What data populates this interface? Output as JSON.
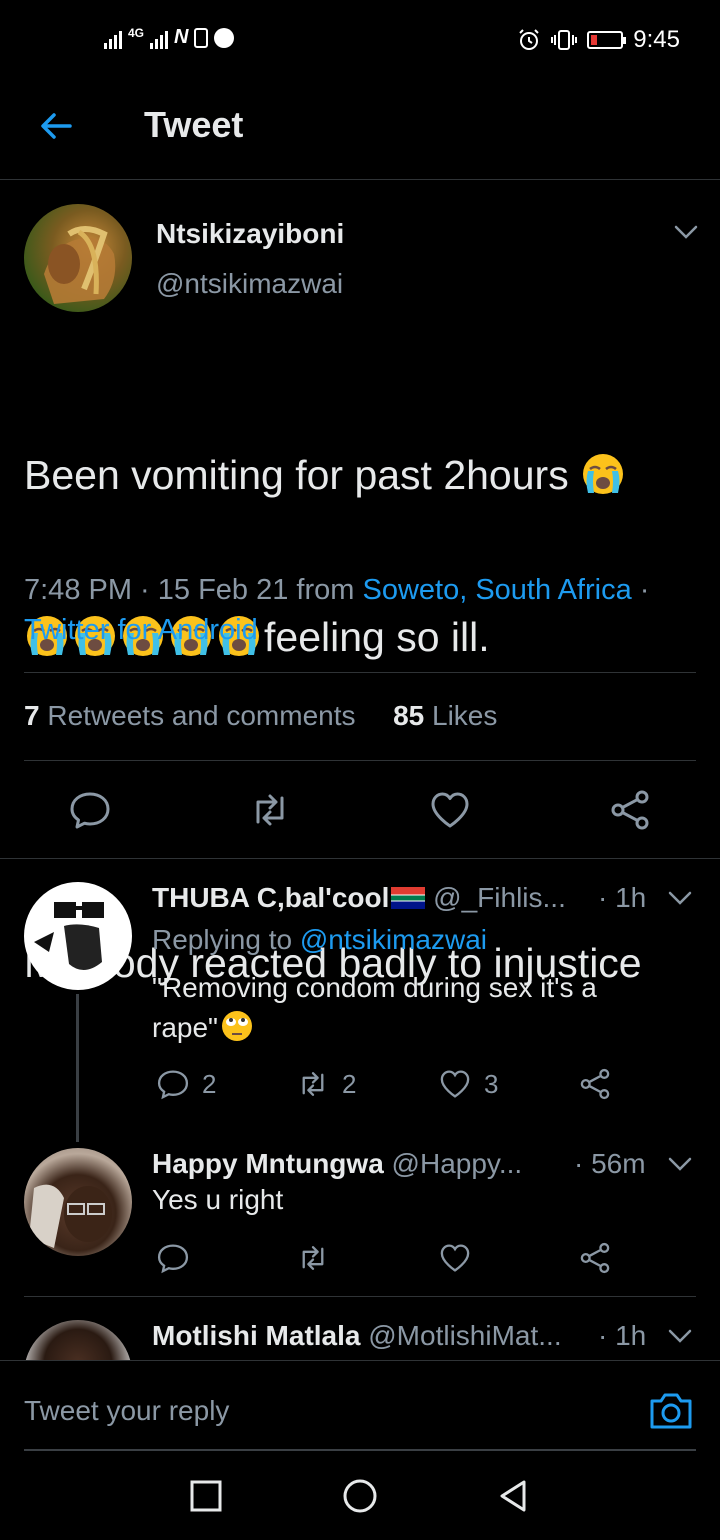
{
  "status_bar": {
    "network": "4G",
    "carrier_badge": "N",
    "time": "9:45"
  },
  "header": {
    "title": "Tweet"
  },
  "tweet": {
    "author_name": "Ntsikizayiboni",
    "author_handle": "@ntsikimazwai",
    "text_line1": "Been vomiting for past 2hours ",
    "text_line2": "feeling so ill.",
    "text_line3": "My body reacted badly to injustice",
    "emoji": "loudly-crying-face",
    "timestamp": "7:48 PM · 15 Feb 21 from ",
    "location": "Soweto, South Africa",
    "sep": " ·",
    "source": "Twitter for Android",
    "retweets_count": "7",
    "retweets_label": " Retweets and comments",
    "likes_count": "85",
    "likes_label": " Likes"
  },
  "replies": [
    {
      "name": "THUBA C,bal'cool",
      "handle": " @_Fihlis...",
      "time": "· 1h",
      "replying_prefix": "Replying to ",
      "replying_to": "@ntsikimazwai",
      "text_line1": "\"Removing condom during sex it's a",
      "text_line2": "rape\"",
      "comments": "2",
      "retweets": "2",
      "likes": "3"
    },
    {
      "name": "Happy Mntungwa",
      "handle": " @Happy...",
      "time": "· 56m",
      "text_line1": "Yes u right"
    },
    {
      "name": "Motlishi Matlala",
      "handle": " @MotlishiMat...",
      "time": "· 1h"
    }
  ],
  "compose": {
    "placeholder": "Tweet your reply"
  },
  "colors": {
    "background": "#000000",
    "accent": "#1d9bf0",
    "secondary_text": "#8b98a5"
  }
}
